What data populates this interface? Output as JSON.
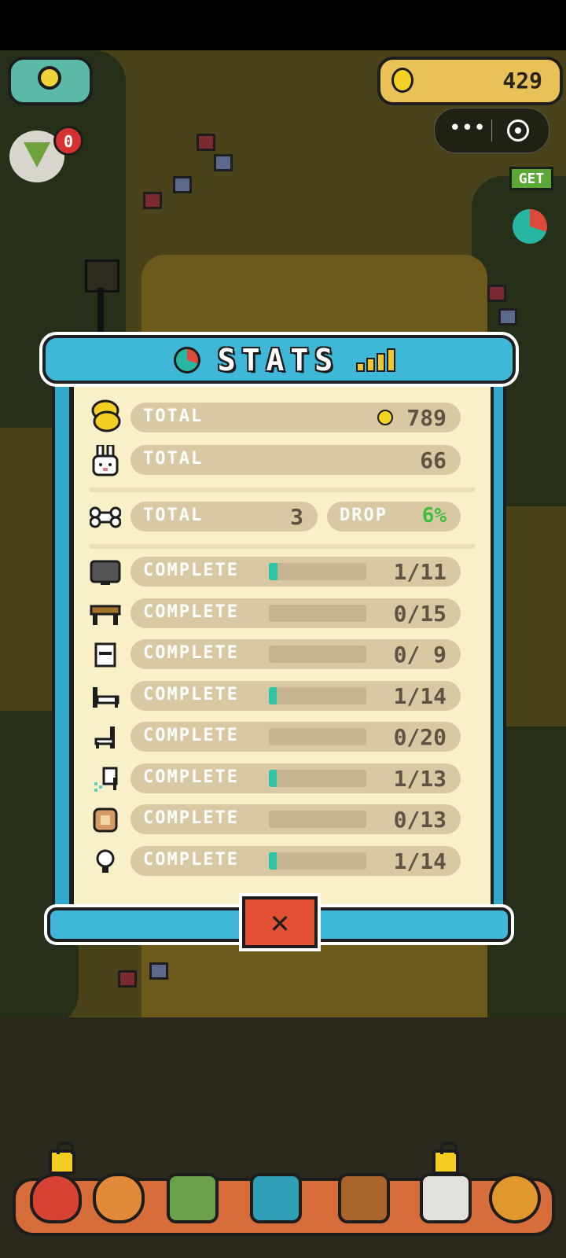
{
  "hud": {
    "coins": "429",
    "heart_badge": "0",
    "get_label": "GET"
  },
  "stats": {
    "title": "STATS",
    "total_coins_label": "TOTAL",
    "total_coins_value": "789",
    "total_rabbits_label": "TOTAL",
    "total_rabbits_value": "66",
    "bones_label": "TOTAL",
    "bones_value": "3",
    "drop_label": "DROP",
    "drop_value": "6%",
    "complete_rows": [
      {
        "icon": "tv-icon",
        "label": "COMPLETE",
        "value": "1/11",
        "progress": 0.09
      },
      {
        "icon": "table-icon",
        "label": "COMPLETE",
        "value": "0/15",
        "progress": 0
      },
      {
        "icon": "cabinet-icon",
        "label": "COMPLETE",
        "value": "0/ 9",
        "progress": 0
      },
      {
        "icon": "bed-icon",
        "label": "COMPLETE",
        "value": "1/14",
        "progress": 0.07
      },
      {
        "icon": "chair-icon",
        "label": "COMPLETE",
        "value": "0/20",
        "progress": 0
      },
      {
        "icon": "shower-icon",
        "label": "COMPLETE",
        "value": "1/13",
        "progress": 0.08
      },
      {
        "icon": "rug-icon",
        "label": "COMPLETE",
        "value": "0/13",
        "progress": 0
      },
      {
        "icon": "lightbulb-icon",
        "label": "COMPLETE",
        "value": "1/14",
        "progress": 0.07
      }
    ]
  },
  "colors": {
    "panel_blue": "#3fb7d7",
    "paper": "#faf0c8",
    "pill": "#d9c9a3",
    "progress": "#2ec4a5",
    "drop_green": "#3cbf3a",
    "close_red": "#e45034"
  },
  "tabs": [
    "heart-lock-tab",
    "shiba-tab",
    "register-tab",
    "camera-tab",
    "sofa-tab",
    "box-lock-tab",
    "paw-tab"
  ]
}
